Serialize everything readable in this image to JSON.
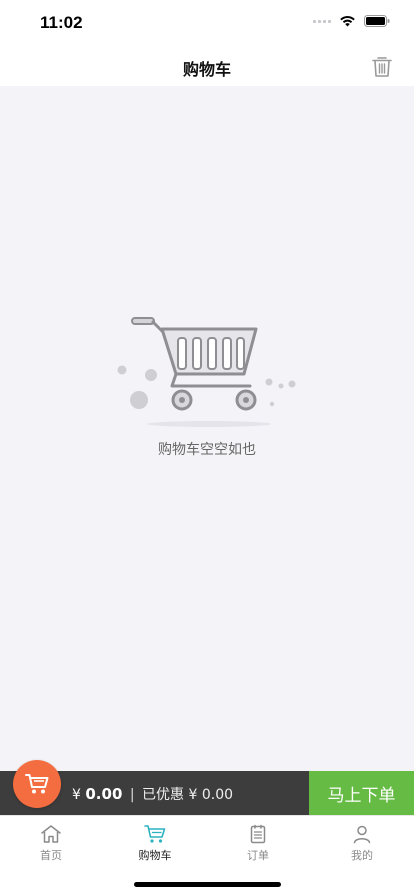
{
  "status_bar": {
    "time": "11:02"
  },
  "nav": {
    "title": "购物车"
  },
  "empty_state": {
    "message": "购物车空空如也"
  },
  "checkout": {
    "currency": "¥",
    "total": "0.00",
    "separator": "|",
    "discount_label": "已优惠",
    "discount_value": "0.00",
    "order_button": "马上下单"
  },
  "tabs": [
    {
      "label": "首页",
      "icon": "home-icon",
      "active": false
    },
    {
      "label": "购物车",
      "icon": "cart-icon",
      "active": true
    },
    {
      "label": "订单",
      "icon": "clipboard-icon",
      "active": false
    },
    {
      "label": "我的",
      "icon": "user-icon",
      "active": false
    }
  ],
  "colors": {
    "accent_green": "#66bb44",
    "fab_orange": "#f46d41",
    "active_tab_teal": "#2bb3c0",
    "checkout_bar": "#3d3d3d"
  }
}
